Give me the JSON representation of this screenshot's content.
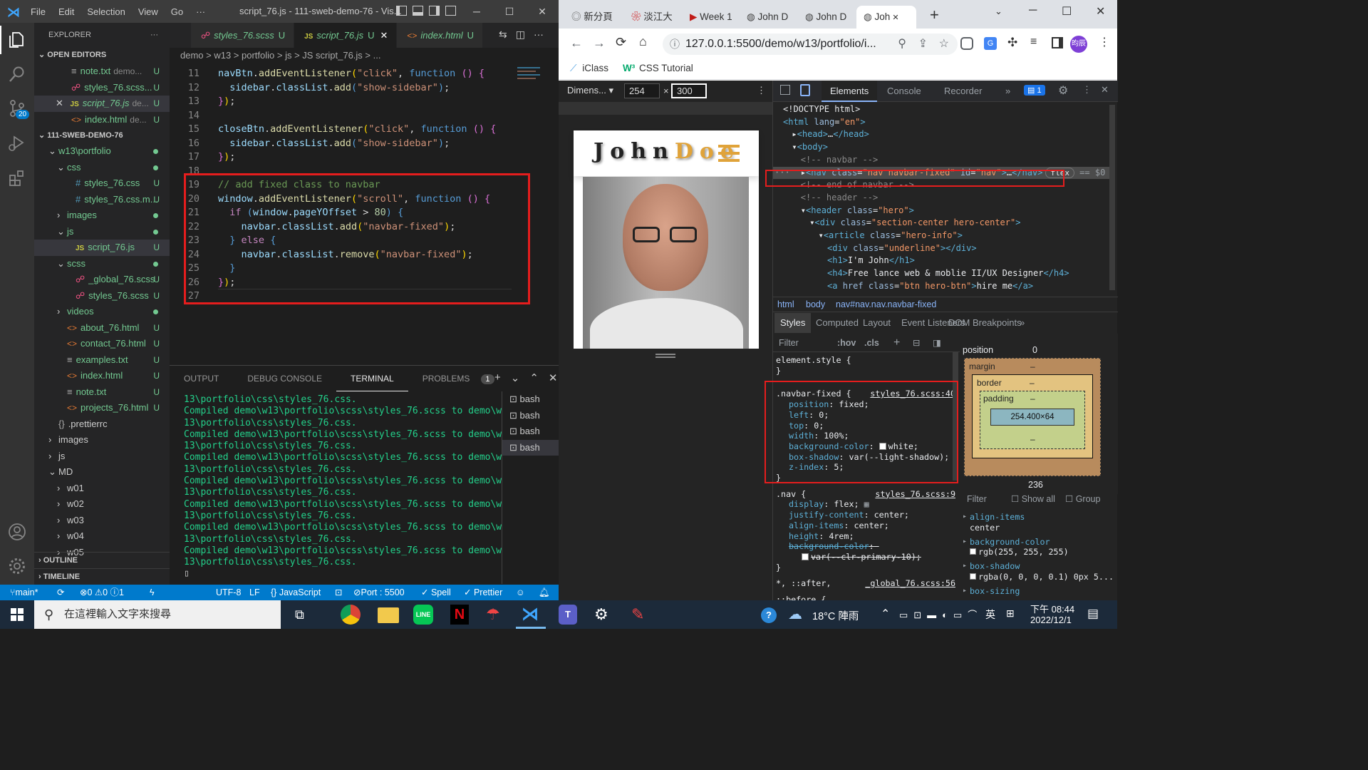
{
  "vscode": {
    "menu": [
      "File",
      "Edit",
      "Selection",
      "View",
      "Go",
      "···"
    ],
    "window_title": "script_76.js - 111-sweb-demo-76 - Vis...",
    "explorer_title": "EXPLORER",
    "open_editors": "OPEN EDITORS",
    "open_files": [
      {
        "name": "note.txt",
        "dir": "demo...",
        "status": "U",
        "icon": "txt"
      },
      {
        "name": "styles_76.scss...",
        "dir": "",
        "status": "U",
        "icon": "scss"
      },
      {
        "name": "script_76.js",
        "dir": "de...",
        "status": "U",
        "icon": "js"
      },
      {
        "name": "index.html",
        "dir": "de...",
        "status": "U",
        "icon": "html"
      }
    ],
    "project": "111-SWEB-DEMO-76",
    "tree": [
      {
        "label": "w13\\portfolio",
        "indent": 1,
        "arrow": "down",
        "dot": true
      },
      {
        "label": "css",
        "indent": 2,
        "arrow": "down",
        "dot": true
      },
      {
        "label": "styles_76.css",
        "indent": 3,
        "icon": "css",
        "status": "U"
      },
      {
        "label": "styles_76.css.m...",
        "indent": 3,
        "icon": "css",
        "status": "U"
      },
      {
        "label": "images",
        "indent": 2,
        "arrow": "right",
        "dot": true
      },
      {
        "label": "js",
        "indent": 2,
        "arrow": "down",
        "dot": true
      },
      {
        "label": "script_76.js",
        "indent": 3,
        "icon": "js",
        "status": "U",
        "selected": true
      },
      {
        "label": "scss",
        "indent": 2,
        "arrow": "down",
        "dot": true
      },
      {
        "label": "_global_76.scss",
        "indent": 3,
        "icon": "scss",
        "status": "U"
      },
      {
        "label": "styles_76.scss",
        "indent": 3,
        "icon": "scss",
        "status": "U"
      },
      {
        "label": "videos",
        "indent": 2,
        "arrow": "right",
        "dot": true
      },
      {
        "label": "about_76.html",
        "indent": 2,
        "icon": "html",
        "status": "U"
      },
      {
        "label": "contact_76.html",
        "indent": 2,
        "icon": "html",
        "status": "U"
      },
      {
        "label": "examples.txt",
        "indent": 2,
        "icon": "txt",
        "status": "U"
      },
      {
        "label": "index.html",
        "indent": 2,
        "icon": "html",
        "status": "U"
      },
      {
        "label": "note.txt",
        "indent": 2,
        "icon": "txt",
        "status": "U"
      },
      {
        "label": "projects_76.html",
        "indent": 2,
        "icon": "html",
        "status": "U"
      },
      {
        "label": ".prettierrc",
        "indent": 1,
        "icon": "conf"
      },
      {
        "label": "images",
        "indent": 1,
        "arrow": "right"
      },
      {
        "label": "js",
        "indent": 1,
        "arrow": "right"
      },
      {
        "label": "MD",
        "indent": 1,
        "arrow": "down"
      },
      {
        "label": "w01",
        "indent": 2,
        "arrow": "right"
      },
      {
        "label": "w02",
        "indent": 2,
        "arrow": "right"
      },
      {
        "label": "w03",
        "indent": 2,
        "arrow": "right"
      },
      {
        "label": "w04",
        "indent": 2,
        "arrow": "right"
      },
      {
        "label": "w05",
        "indent": 2,
        "arrow": "right"
      }
    ],
    "outline": "OUTLINE",
    "timeline": "TIMELINE",
    "scm_badge": "20",
    "tabs": [
      {
        "label": "styles_76.scss",
        "status": "U",
        "icon": "scss"
      },
      {
        "label": "script_76.js",
        "status": "U",
        "icon": "js",
        "active": true
      },
      {
        "label": "index.html",
        "status": "U",
        "icon": "html"
      }
    ],
    "breadcrumb": "demo > w13 > portfolio > js > JS script_76.js > ...",
    "code_lines": [
      {
        "n": "11",
        "html": "<span class='v'>navBtn</span><span class='w'>.</span><span class='f'>addEventListener</span><span class='p'>(</span><span class='s'>\"click\"</span><span class='w'>, </span><span class='k'>function</span><span class='w'> </span><span class='p2'>()</span><span class='w'> </span><span class='p2'>{</span>"
      },
      {
        "n": "12",
        "html": "  <span class='v'>sidebar</span><span class='w'>.</span><span class='v'>classList</span><span class='w'>.</span><span class='f'>add</span><span class='k'>(</span><span class='s'>\"show-sidebar\"</span><span class='k'>)</span><span class='w'>;</span>"
      },
      {
        "n": "13",
        "html": "<span class='p2'>}</span><span class='p'>)</span><span class='w'>;</span>"
      },
      {
        "n": "14",
        "html": ""
      },
      {
        "n": "15",
        "html": "<span class='v'>closeBtn</span><span class='w'>.</span><span class='f'>addEventListener</span><span class='p'>(</span><span class='s'>\"click\"</span><span class='w'>, </span><span class='k'>function</span><span class='w'> </span><span class='p2'>()</span><span class='w'> </span><span class='p2'>{</span>"
      },
      {
        "n": "16",
        "html": "  <span class='v'>sidebar</span><span class='w'>.</span><span class='v'>classList</span><span class='w'>.</span><span class='f'>add</span><span class='k'>(</span><span class='s'>\"show-sidebar\"</span><span class='k'>)</span><span class='w'>;</span>"
      },
      {
        "n": "17",
        "html": "<span class='p2'>}</span><span class='p'>)</span><span class='w'>;</span>"
      },
      {
        "n": "18",
        "html": ""
      },
      {
        "n": "19",
        "html": "<span class='c'>// add fixed class to navbar</span>"
      },
      {
        "n": "20",
        "html": "<span class='v'>window</span><span class='w'>.</span><span class='f'>addEventListener</span><span class='p'>(</span><span class='s'>\"scroll\"</span><span class='w'>, </span><span class='k'>function</span><span class='w'> </span><span class='p2'>()</span><span class='w'> </span><span class='p2'>{</span>"
      },
      {
        "n": "21",
        "html": "  <span class='kw'>if</span><span class='w'> </span><span class='k'>(</span><span class='v'>window</span><span class='w'>.</span><span class='v'>pageYOffset</span><span class='w'> &gt; </span><span class='n'>80</span><span class='k'>)</span><span class='w'> </span><span class='k'>{</span>"
      },
      {
        "n": "22",
        "html": "    <span class='v'>navbar</span><span class='w'>.</span><span class='v'>classList</span><span class='w'>.</span><span class='f'>add</span><span class='p'>(</span><span class='s'>\"navbar-fixed\"</span><span class='p'>)</span><span class='w'>;</span>"
      },
      {
        "n": "23",
        "html": "  <span class='k'>}</span><span class='w'> </span><span class='kw'>else</span><span class='w'> </span><span class='k'>{</span>"
      },
      {
        "n": "24",
        "html": "    <span class='v'>navbar</span><span class='w'>.</span><span class='v'>classList</span><span class='w'>.</span><span class='f'>remove</span><span class='p'>(</span><span class='s'>\"navbar-fixed\"</span><span class='p'>)</span><span class='w'>;</span>"
      },
      {
        "n": "25",
        "html": "  <span class='k'>}</span>"
      },
      {
        "n": "26",
        "html": "<span class='p2'>}</span><span class='p'>)</span><span class='w'>;</span>"
      },
      {
        "n": "27",
        "html": ""
      }
    ],
    "panel_tabs": [
      "OUTPUT",
      "DEBUG CONSOLE",
      "TERMINAL",
      "PROBLEMS"
    ],
    "problems_count": "1",
    "terminal_lines": [
      "13\\portfolio\\css\\styles_76.css.",
      "Compiled demo\\w13\\portfolio\\scss\\styles_76.scss to demo\\w",
      "13\\portfolio\\css\\styles_76.css.",
      "Compiled demo\\w13\\portfolio\\scss\\styles_76.scss to demo\\w",
      "13\\portfolio\\css\\styles_76.css.",
      "Compiled demo\\w13\\portfolio\\scss\\styles_76.scss to demo\\w",
      "13\\portfolio\\css\\styles_76.css.",
      "Compiled demo\\w13\\portfolio\\scss\\styles_76.scss to demo\\w",
      "13\\portfolio\\css\\styles_76.css.",
      "Compiled demo\\w13\\portfolio\\scss\\styles_76.scss to demo\\w",
      "13\\portfolio\\css\\styles_76.css.",
      "Compiled demo\\w13\\portfolio\\scss\\styles_76.scss to demo\\w",
      "13\\portfolio\\css\\styles_76.css.",
      "Compiled demo\\w13\\portfolio\\scss\\styles_76.scss to demo\\w",
      "13\\portfolio\\css\\styles_76.css.",
      "▯"
    ],
    "terminals": [
      "bash",
      "bash",
      "bash",
      "bash"
    ],
    "status": {
      "branch": "main*",
      "problems": "⊗0 ⚠0 ⓘ1",
      "encoding": "UTF-8",
      "eol": "LF",
      "language": "{} JavaScript",
      "port": "Port : 5500",
      "spell": "✓ Spell",
      "prettier": "✓ Prettier"
    }
  },
  "chrome": {
    "tabs": [
      "新分頁",
      "淡江大",
      "Week 1",
      "John D",
      "John D",
      "Joh"
    ],
    "url": "127.0.0.1:5500/demo/w13/portfolio/i...",
    "bookmarks": [
      "iClass",
      "CSS Tutorial"
    ],
    "profile": "昀辰",
    "device": {
      "label": "Dimens...",
      "width": "254",
      "height": "300"
    },
    "preview": {
      "brand_first": "John",
      "brand_last": "Doe"
    },
    "devtools_tabs": [
      "Elements",
      "Console",
      "Recorder",
      "»"
    ],
    "issues_badge": "1",
    "dom_lines": [
      {
        "i": 0,
        "html": "<span class='tx'>&lt;!DOCTYPE html&gt;</span>"
      },
      {
        "i": 0,
        "html": "<span class='tg'>&lt;html</span> <span class='at'>lang</span><span class='tx'>=</span><span class='av'>\"en\"</span><span class='tg'>&gt;</span>"
      },
      {
        "i": 1,
        "html": "<span class='tx'>▸</span><span class='tg'>&lt;head&gt;</span><span class='tx'>…</span><span class='tg'>&lt;/head&gt;</span>"
      },
      {
        "i": 1,
        "html": "<span class='tx'>▾</span><span class='tg'>&lt;body&gt;</span>"
      },
      {
        "i": 2,
        "html": "<span class='cm'>&lt;!-- navbar --&gt;</span>"
      },
      {
        "i": 2,
        "html": "<span class='tx'>▸</span><span class='tg'>&lt;nav</span> <span class='at'>class</span><span class='tx'>=</span><span class='av'>\"nav navbar-fixed\"</span> <span class='at'>id</span><span class='tx'>=</span><span class='av'>\"nav\"</span><span class='tg'>&gt;</span><span class='tx'>…</span><span class='tg'>&lt;/nav&gt;</span>",
        "selected": true
      },
      {
        "i": 2,
        "html": "<span class='cm'>&lt;!-- end of navbar --&gt;</span>"
      },
      {
        "i": 2,
        "html": "<span class='cm'>&lt;!-- header --&gt;</span>"
      },
      {
        "i": 2,
        "html": "<span class='tx'>▾</span><span class='tg'>&lt;header</span> <span class='at'>class</span><span class='tx'>=</span><span class='av'>\"hero\"</span><span class='tg'>&gt;</span>"
      },
      {
        "i": 3,
        "html": "<span class='tx'>▾</span><span class='tg'>&lt;div</span> <span class='at'>class</span><span class='tx'>=</span><span class='av'>\"section-center hero-center\"</span><span class='tg'>&gt;</span>"
      },
      {
        "i": 4,
        "html": "<span class='tx'>▾</span><span class='tg'>&lt;article</span> <span class='at'>class</span><span class='tx'>=</span><span class='av'>\"hero-info\"</span><span class='tg'>&gt;</span>"
      },
      {
        "i": 5,
        "html": "<span class='tg'>&lt;div</span> <span class='at'>class</span><span class='tx'>=</span><span class='av'>\"underline\"</span><span class='tg'>&gt;&lt;/div&gt;</span>"
      },
      {
        "i": 5,
        "html": "<span class='tg'>&lt;h1&gt;</span><span class='tx'>I'm John</span><span class='tg'>&lt;/h1&gt;</span>"
      },
      {
        "i": 5,
        "html": "<span class='tg'>&lt;h4&gt;</span><span class='tx'>Free lance web &amp; moblie II/UX Designer</span><span class='tg'>&lt;/h4&gt;</span>"
      },
      {
        "i": 5,
        "html": "<span class='tg'>&lt;a</span> <span class='at'>href</span> <span class='at'>class</span><span class='tx'>=</span><span class='av'>\"btn hero-btn\"</span><span class='tg'>&gt;</span><span class='tx'>hire me</span><span class='tg'>&lt;/a&gt;</span>"
      }
    ],
    "dom_breadcrumb": [
      "html",
      "body",
      "nav#nav.nav.navbar-fixed"
    ],
    "style_tabs": [
      "Styles",
      "Computed",
      "Layout",
      "Event Listeners",
      "DOM Breakpoints",
      "»"
    ],
    "filter_placeholder": "Filter",
    "hov": ":hov",
    "cls": ".cls",
    "rules": [
      {
        "selector": "element.style {",
        "source": "",
        "props": [],
        "close": "}"
      },
      {
        "selector": ".navbar-fixed {",
        "source": "styles_76.scss:40",
        "props": [
          [
            "position",
            "fixed;"
          ],
          [
            "left",
            "0;"
          ],
          [
            "top",
            "0;"
          ],
          [
            "width",
            "100%;"
          ],
          [
            "background-color",
            "white;"
          ],
          [
            "box-shadow",
            "var(--light-shadow);"
          ],
          [
            "z-index",
            "5;"
          ]
        ],
        "close": "}"
      },
      {
        "selector": ".nav {",
        "source": "styles_76.scss:9",
        "props": [
          [
            "display",
            "flex;"
          ],
          [
            "justify-content",
            "center;"
          ],
          [
            "align-items",
            "center;"
          ],
          [
            "height",
            "4rem;"
          ],
          [
            "background-color",
            ""
          ],
          [
            "",
            "var(--clr-primary-10);"
          ]
        ],
        "close": "}"
      },
      {
        "selector": "*, ::after,",
        "source": "_global_76.scss:56",
        "props": [],
        "close": ""
      },
      {
        "selector": "::before {",
        "source": "",
        "props": [],
        "close": ""
      }
    ],
    "box": {
      "position_label": "position",
      "position_value": "0",
      "margin": "margin",
      "border": "border",
      "padding": "padding",
      "dash": "–",
      "content": "254.400×64",
      "bottom": "236"
    },
    "computed_filter": "Filter",
    "show_all": "Show all",
    "group": "Group",
    "computed": [
      {
        "prop": "align-items",
        "val": "center"
      },
      {
        "prop": "background-color",
        "val": "rgb(255, 255, 255)"
      },
      {
        "prop": "box-shadow",
        "val": "rgba(0, 0, 0, 0.1) 0px 5..."
      },
      {
        "prop": "box-sizing",
        "val": ""
      }
    ]
  },
  "taskbar": {
    "search_placeholder": "在這裡輸入文字來搜尋",
    "weather": "18°C 陣雨",
    "ime": "英",
    "time": "下午 08:44",
    "date": "2022/12/1"
  },
  "colors": {
    "accent": "#007acc",
    "highlight": "#e51d1d",
    "brand_gold": "#e0a33a"
  }
}
